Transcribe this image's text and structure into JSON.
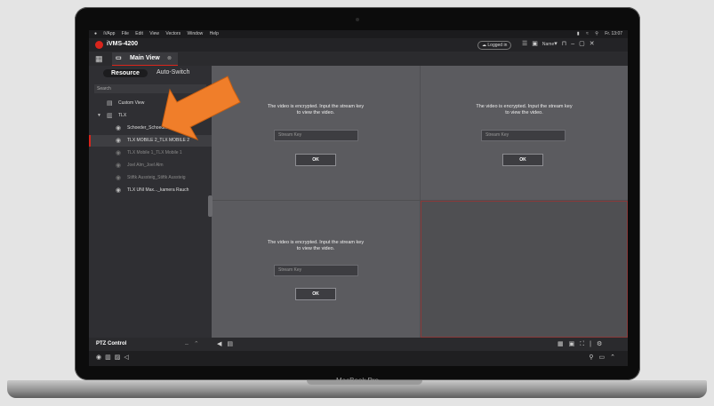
{
  "menubar": {
    "apple": "",
    "items": [
      "iVApp",
      "File",
      "Edit",
      "View",
      "Vectors",
      "Window",
      "Help"
    ],
    "clock": "Fr. 13:07"
  },
  "window": {
    "title": "iVMS-4200",
    "logged_in": "Logged in",
    "user_name": "Name"
  },
  "tabs": {
    "main_view": "Main View"
  },
  "sidebar": {
    "resource_tab": "Resource",
    "autoswitch_tab": "Auto-Switch",
    "search_placeholder": "Search",
    "tree": [
      {
        "label": "Custom View",
        "icon": "view-icon"
      },
      {
        "label": "TLX",
        "icon": "folder-icon"
      },
      {
        "label": "Schoeder_Schoeder",
        "icon": "camera-icon"
      },
      {
        "label": "TLX MOBILE 2_TLX MOBILE 2",
        "icon": "camera-icon"
      },
      {
        "label": "TLX Mobile 1_TLX Mobile 1",
        "icon": "camera-icon"
      },
      {
        "label": "Joel Alm_Joel Alm",
        "icon": "camera-icon"
      },
      {
        "label": "Stiftk Aussteig_Stiftk Aussteig",
        "icon": "camera-icon"
      },
      {
        "label": "TLX UNI Max..._kamera Rauch",
        "icon": "camera-icon"
      }
    ]
  },
  "panes": [
    {
      "message_line1": "The video is encrypted. Input the stream key",
      "message_line2": "to view the video.",
      "key_placeholder": "Stream Key",
      "ok_label": "OK"
    },
    {
      "message_line1": "The video is encrypted. Input the stream key",
      "message_line2": "to view the video.",
      "key_placeholder": "Stream Key",
      "ok_label": "OK"
    },
    {
      "message_line1": "The video is encrypted. Input the stream key",
      "message_line2": "to view the video.",
      "key_placeholder": "Stream Key",
      "ok_label": "OK"
    }
  ],
  "bottom": {
    "ptz_label": "PTZ Control"
  },
  "device": {
    "label": "MacBook Pro"
  },
  "colors": {
    "accent": "#d9251c",
    "arrow": "#f07e2a"
  }
}
